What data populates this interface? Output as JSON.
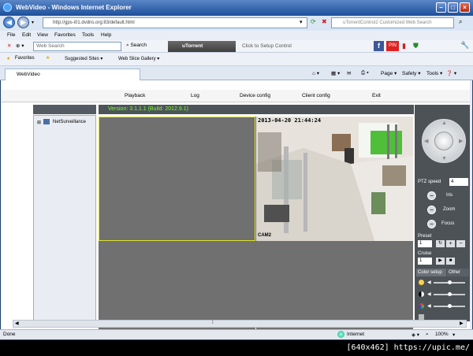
{
  "window": {
    "title": "WebVideo - Windows Internet Explorer"
  },
  "address": {
    "url": "http://gps-i01.dvdns.org:83/default.html",
    "search_placeholder": "uTorrentControl2 Customized Web Search"
  },
  "menu": [
    "File",
    "Edit",
    "View",
    "Favorites",
    "Tools",
    "Help"
  ],
  "toolbar": {
    "search_box": "Web Search",
    "search_label": "Search",
    "utorrent": "uTorrent",
    "setup": "Click to Setup Control"
  },
  "favorites": {
    "label": "Favorites",
    "suggested": "Suggested Sites ▾",
    "gallery": "Web Slice Gallery ▾"
  },
  "tab": {
    "label": "WebVideo"
  },
  "tab_tools": {
    "page": "Page ▾",
    "safety": "Safety ▾",
    "tools": "Tools ▾",
    "help": "❓ ▾"
  },
  "nav": [
    "Playback",
    "Log",
    "Device config",
    "Client config",
    "Exit"
  ],
  "version": "Version: 3.1.1.1 (Build: 2012.9.1)",
  "tree": {
    "node": "NetSurveillance"
  },
  "camera": {
    "timestamp": "2013-04-20 21:44:24",
    "name": "CAM2"
  },
  "ptz": {
    "speed_label": "PTZ speed",
    "speed_value": "4",
    "iris": "Iris",
    "zoom": "Zoom",
    "focus": "Focus",
    "preset": "Preset",
    "preset_value": "1",
    "cruise": "Cruise",
    "cruise_value": "1"
  },
  "color_tabs": [
    "Color setup",
    "Other"
  ],
  "status": {
    "left": "Done",
    "zone": "Internet",
    "zoom": "100%"
  },
  "caption": "[640x462] https://upic.me/"
}
